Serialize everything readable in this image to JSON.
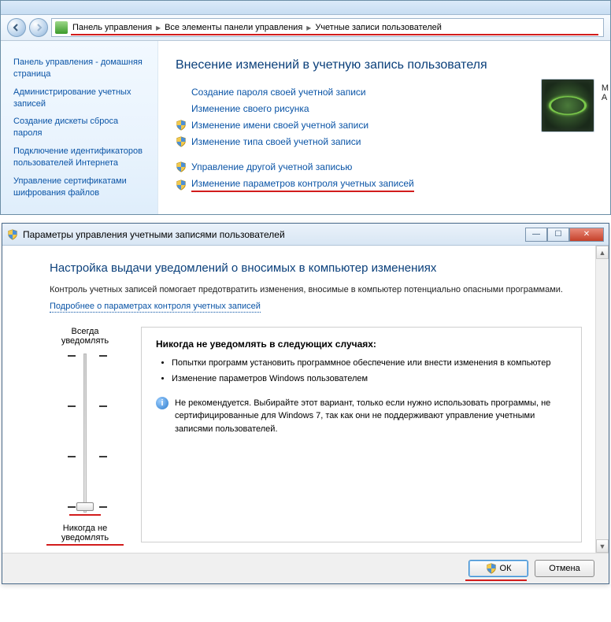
{
  "breadcrumb": {
    "items": [
      "Панель управления",
      "Все элементы панели управления",
      "Учетные записи пользователей"
    ]
  },
  "sidebar": {
    "home": "Панель управления - домашняя страница",
    "links": [
      "Администрирование учетных записей",
      "Создание дискеты сброса пароля",
      "Подключение идентификаторов пользователей Интернета",
      "Управление сертификатами шифрования файлов"
    ]
  },
  "main": {
    "heading": "Внесение изменений в учетную запись пользователя",
    "links": [
      {
        "label": "Создание пароля своей учетной записи",
        "shield": false
      },
      {
        "label": "Изменение своего рисунка",
        "shield": false
      },
      {
        "label": "Изменение имени своей учетной записи",
        "shield": true
      },
      {
        "label": "Изменение типа своей учетной записи",
        "shield": true
      }
    ],
    "links2": [
      {
        "label": "Управление другой учетной записью",
        "shield": true
      },
      {
        "label": "Изменение параметров контроля учетных записей",
        "shield": true,
        "redline": true
      }
    ],
    "avatar_name": "М",
    "avatar_role": "А"
  },
  "uac": {
    "title": "Параметры управления учетными записями пользователей",
    "heading": "Настройка выдачи уведомлений о вносимых в компьютер изменениях",
    "desc": "Контроль учетных записей помогает предотвратить изменения, вносимые в компьютер потенциально опасными программами.",
    "more": "Подробнее о параметрах контроля учетных записей",
    "slider_top": "Всегда уведомлять",
    "slider_bottom": "Никогда не уведомлять",
    "detail_heading": "Никогда не уведомлять в следующих случаях:",
    "bullets": [
      "Попытки программ установить программное обеспечение или внести изменения в компьютер",
      "Изменение параметров Windows пользователем"
    ],
    "info": "Не рекомендуется. Выбирайте этот вариант, только если нужно использовать программы, не сертифицированные для Windows 7, так как они не поддерживают управление учетными записями пользователей.",
    "ok": "ОК",
    "cancel": "Отмена"
  }
}
